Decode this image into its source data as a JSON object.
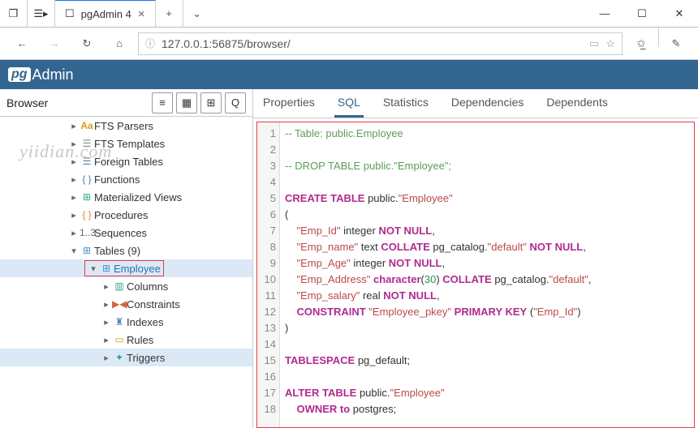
{
  "window": {
    "tab_title": "pgAdmin 4",
    "url": "127.0.0.1:56875/browser/"
  },
  "sidebar": {
    "title": "Browser",
    "watermark": "yiidian.com",
    "nodes": [
      {
        "pad": 84,
        "arrow": "▸",
        "icon_class": "i-aa",
        "icon": "Aa",
        "label": "FTS Parsers"
      },
      {
        "pad": 84,
        "arrow": "▸",
        "icon_class": "i-tpl",
        "icon": "☰",
        "label": "FTS Templates"
      },
      {
        "pad": 84,
        "arrow": "▸",
        "icon_class": "i-fn",
        "icon": "☰",
        "label": "Foreign Tables"
      },
      {
        "pad": 84,
        "arrow": "▸",
        "icon_class": "i-fn",
        "icon": "{ }",
        "label": "Functions"
      },
      {
        "pad": 84,
        "arrow": "▸",
        "icon_class": "i-mv",
        "icon": "⊞",
        "label": "Materialized Views"
      },
      {
        "pad": 84,
        "arrow": "▸",
        "icon_class": "i-proc",
        "icon": "{ }",
        "label": "Procedures"
      },
      {
        "pad": 84,
        "arrow": "▸",
        "icon_class": "i-seq",
        "icon": "1..3",
        "label": "Sequences"
      },
      {
        "pad": 84,
        "arrow": "▾",
        "icon_class": "i-tbl",
        "icon": "⊞",
        "label": "Tables (9)"
      },
      {
        "pad": 104,
        "arrow": "▾",
        "icon_class": "i-tbl",
        "icon": "⊞",
        "label": "Employee",
        "highlighted": true,
        "selected": true
      },
      {
        "pad": 124,
        "arrow": "▸",
        "icon_class": "i-col",
        "icon": "▥",
        "label": "Columns"
      },
      {
        "pad": 124,
        "arrow": "▸",
        "icon_class": "i-con",
        "icon": "▶◀",
        "label": "Constraints"
      },
      {
        "pad": 124,
        "arrow": "▸",
        "icon_class": "i-idx",
        "icon": "♜",
        "label": "Indexes"
      },
      {
        "pad": 124,
        "arrow": "▸",
        "icon_class": "i-rule",
        "icon": "▭",
        "label": "Rules"
      },
      {
        "pad": 124,
        "arrow": "▸",
        "icon_class": "i-trig",
        "icon": "✦",
        "label": "Triggers",
        "selected": true
      }
    ]
  },
  "tabs": {
    "items": [
      "Properties",
      "SQL",
      "Statistics",
      "Dependencies",
      "Dependents"
    ],
    "active_index": 1
  },
  "sql": {
    "lines": [
      {
        "n": 1,
        "tokens": [
          {
            "c": "cm-comment",
            "t": "-- Table: public.Employee"
          }
        ]
      },
      {
        "n": 2,
        "tokens": []
      },
      {
        "n": 3,
        "tokens": [
          {
            "c": "cm-comment",
            "t": "-- DROP TABLE public.\"Employee\";"
          }
        ]
      },
      {
        "n": 4,
        "tokens": []
      },
      {
        "n": 5,
        "tokens": [
          {
            "c": "cm-kw",
            "t": "CREATE TABLE "
          },
          {
            "c": "cm-id",
            "t": "public."
          },
          {
            "c": "cm-str",
            "t": "\"Employee\""
          }
        ]
      },
      {
        "n": 6,
        "tokens": [
          {
            "c": "cm-op",
            "t": "("
          }
        ]
      },
      {
        "n": 7,
        "tokens": [
          {
            "c": "cm-id",
            "t": "    "
          },
          {
            "c": "cm-str",
            "t": "\"Emp_Id\""
          },
          {
            "c": "cm-id",
            "t": " integer "
          },
          {
            "c": "cm-kw",
            "t": "NOT NULL"
          },
          {
            "c": "cm-op",
            "t": ","
          }
        ]
      },
      {
        "n": 8,
        "tokens": [
          {
            "c": "cm-id",
            "t": "    "
          },
          {
            "c": "cm-str",
            "t": "\"Emp_name\""
          },
          {
            "c": "cm-id",
            "t": " text "
          },
          {
            "c": "cm-kw",
            "t": "COLLATE"
          },
          {
            "c": "cm-id",
            "t": " pg_catalog."
          },
          {
            "c": "cm-str",
            "t": "\"default\""
          },
          {
            "c": "cm-id",
            "t": " "
          },
          {
            "c": "cm-kw",
            "t": "NOT NULL"
          },
          {
            "c": "cm-op",
            "t": ","
          }
        ]
      },
      {
        "n": 9,
        "tokens": [
          {
            "c": "cm-id",
            "t": "    "
          },
          {
            "c": "cm-str",
            "t": "\"Emp_Age\""
          },
          {
            "c": "cm-id",
            "t": " integer "
          },
          {
            "c": "cm-kw",
            "t": "NOT NULL"
          },
          {
            "c": "cm-op",
            "t": ","
          }
        ]
      },
      {
        "n": 10,
        "tokens": [
          {
            "c": "cm-id",
            "t": "    "
          },
          {
            "c": "cm-str",
            "t": "\"Emp_Address\""
          },
          {
            "c": "cm-id",
            "t": " "
          },
          {
            "c": "cm-kw",
            "t": "character"
          },
          {
            "c": "cm-op",
            "t": "("
          },
          {
            "c": "cm-num",
            "t": "30"
          },
          {
            "c": "cm-op",
            "t": ")"
          },
          {
            "c": "cm-id",
            "t": " "
          },
          {
            "c": "cm-kw",
            "t": "COLLATE"
          },
          {
            "c": "cm-id",
            "t": " pg_catalog."
          },
          {
            "c": "cm-str",
            "t": "\"default\""
          },
          {
            "c": "cm-op",
            "t": ","
          }
        ]
      },
      {
        "n": 11,
        "tokens": [
          {
            "c": "cm-id",
            "t": "    "
          },
          {
            "c": "cm-str",
            "t": "\"Emp_salary\""
          },
          {
            "c": "cm-id",
            "t": " real "
          },
          {
            "c": "cm-kw",
            "t": "NOT NULL"
          },
          {
            "c": "cm-op",
            "t": ","
          }
        ]
      },
      {
        "n": 12,
        "tokens": [
          {
            "c": "cm-id",
            "t": "    "
          },
          {
            "c": "cm-kw",
            "t": "CONSTRAINT "
          },
          {
            "c": "cm-str",
            "t": "\"Employee_pkey\""
          },
          {
            "c": "cm-id",
            "t": " "
          },
          {
            "c": "cm-kw",
            "t": "PRIMARY KEY"
          },
          {
            "c": "cm-id",
            "t": " ("
          },
          {
            "c": "cm-str",
            "t": "\"Emp_Id\""
          },
          {
            "c": "cm-op",
            "t": ")"
          }
        ]
      },
      {
        "n": 13,
        "tokens": [
          {
            "c": "cm-op",
            "t": ")"
          }
        ]
      },
      {
        "n": 14,
        "tokens": []
      },
      {
        "n": 15,
        "tokens": [
          {
            "c": "cm-kw",
            "t": "TABLESPACE"
          },
          {
            "c": "cm-id",
            "t": " pg_default;"
          }
        ]
      },
      {
        "n": 16,
        "tokens": []
      },
      {
        "n": 17,
        "tokens": [
          {
            "c": "cm-kw",
            "t": "ALTER TABLE "
          },
          {
            "c": "cm-id",
            "t": "public."
          },
          {
            "c": "cm-str",
            "t": "\"Employee\""
          }
        ]
      },
      {
        "n": 18,
        "tokens": [
          {
            "c": "cm-id",
            "t": "    "
          },
          {
            "c": "cm-kw",
            "t": "OWNER to"
          },
          {
            "c": "cm-id",
            "t": " postgres;"
          }
        ]
      }
    ]
  }
}
